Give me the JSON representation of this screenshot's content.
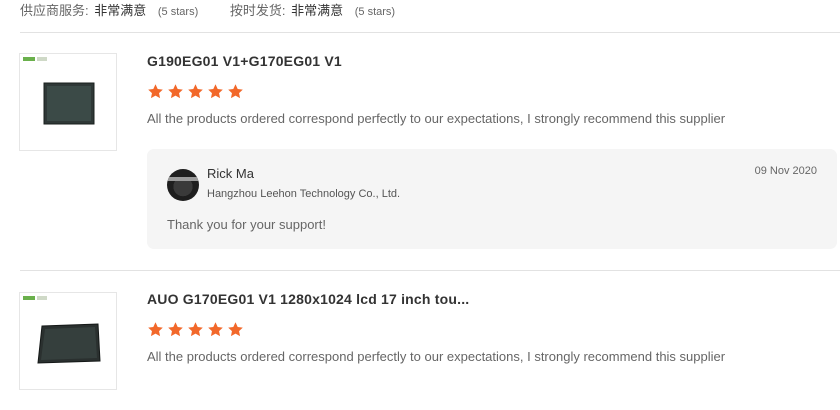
{
  "ratings": [
    {
      "label": "供应商服务:",
      "value": "非常满意",
      "stars": "(5 stars)"
    },
    {
      "label": "按时发货:",
      "value": "非常满意",
      "stars": "(5 stars)"
    }
  ],
  "reviews": [
    {
      "product_title": "G190EG01 V1+G170EG01 V1",
      "stars": 5,
      "text": "All the products ordered correspond perfectly to our expectations, I strongly recommend this supplier",
      "reply": {
        "name": "Rick Ma",
        "company": "Hangzhou Leehon Technology Co., Ltd.",
        "date": "09 Nov 2020",
        "text": "Thank you for your support!"
      }
    },
    {
      "product_title": "AUO G170EG01 V1 1280x1024 lcd 17 inch tou...",
      "stars": 5,
      "text": "All the products ordered correspond perfectly to our expectations, I strongly recommend this supplier"
    }
  ],
  "colors": {
    "star": "#f2682a",
    "reply_bg": "#f5f5f5",
    "divider": "#e2e2e2"
  }
}
